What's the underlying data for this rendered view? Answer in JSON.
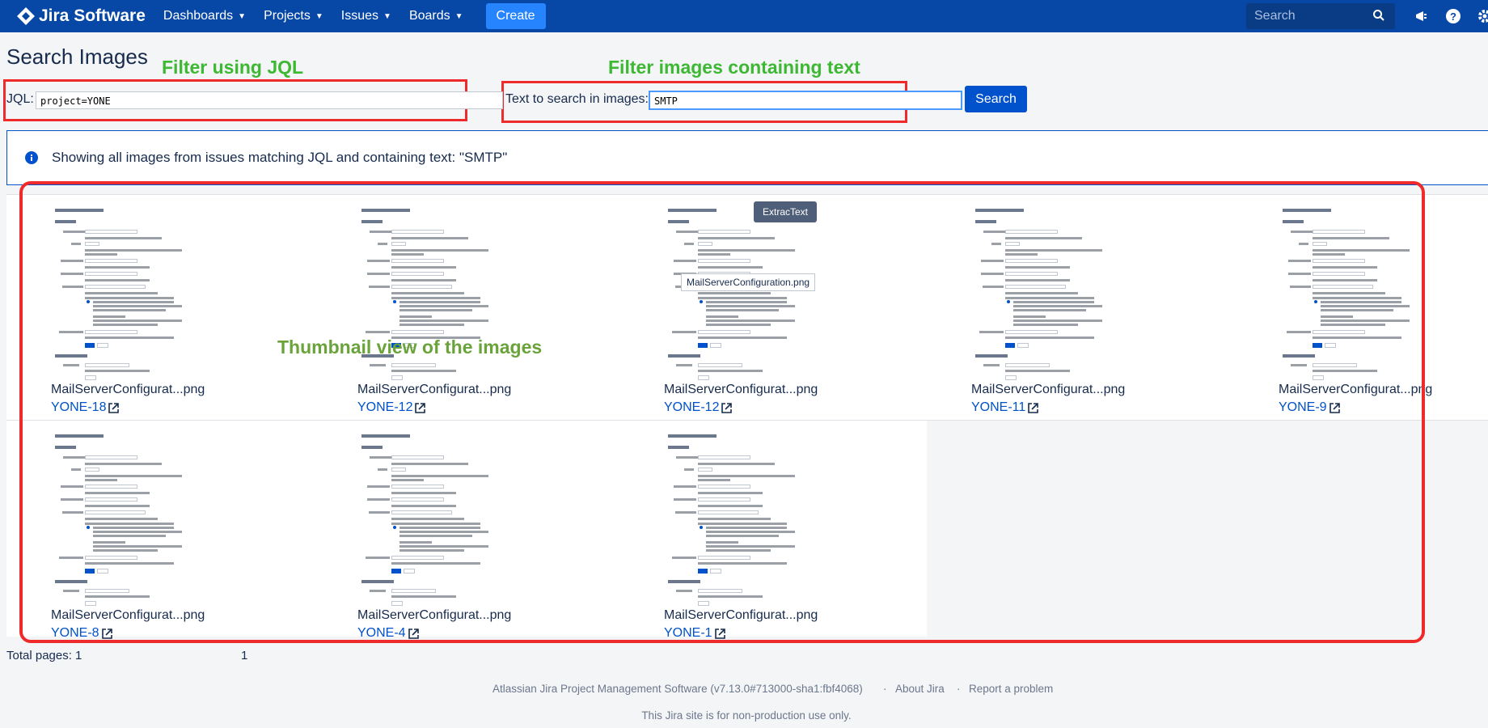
{
  "header": {
    "logo_text": "Jira Software",
    "nav": [
      {
        "label": "Dashboards"
      },
      {
        "label": "Projects"
      },
      {
        "label": "Issues"
      },
      {
        "label": "Boards"
      }
    ],
    "create_label": "Create",
    "search_placeholder": "Search"
  },
  "page": {
    "title": "Search Images",
    "annotations": {
      "jql": "Filter using JQL",
      "text": "Filter images containing text",
      "thumbs": "Thumbnail view of the images"
    },
    "jql_label": "JQL:",
    "jql_value": "project=YONE",
    "text_label": "Text to search in images:",
    "text_value": "SMTP",
    "search_button": "Search",
    "info_message": "Showing all images from issues matching JQL and containing text: \"SMTP\""
  },
  "thumbnails": {
    "screenshot_title": "Mail server configuration",
    "section1": "Mail settings",
    "section2": "Send a test email",
    "tooltip": "ExtracText",
    "hover_filename": "MailServerConfiguration.png",
    "items": [
      {
        "filename": "MailServerConfigurat...png",
        "key": "YONE-18"
      },
      {
        "filename": "MailServerConfigurat...png",
        "key": "YONE-12"
      },
      {
        "filename": "MailServerConfigurat...png",
        "key": "YONE-12"
      },
      {
        "filename": "MailServerConfigurat...png",
        "key": "YONE-11"
      },
      {
        "filename": "MailServerConfigurat...png",
        "key": "YONE-9"
      },
      {
        "filename": "MailServerConfigurat...png",
        "key": "YONE-8"
      },
      {
        "filename": "MailServerConfigurat...png",
        "key": "YONE-4"
      },
      {
        "filename": "MailServerConfigurat...png",
        "key": "YONE-1"
      }
    ]
  },
  "pagination": {
    "total_label": "Total pages: 1",
    "current_page": "1"
  },
  "footer": {
    "product": "Atlassian Jira Project Management Software (v7.13.0#713000-sha1:fbf4068)",
    "about": "About Jira",
    "report": "Report a problem",
    "notice": "This Jira site is for non-production use only."
  },
  "colors": {
    "header_bg": "#0747a6",
    "primary": "#0052cc",
    "annotation_red": "#ee2a2a",
    "annotation_green": "#3db832"
  }
}
